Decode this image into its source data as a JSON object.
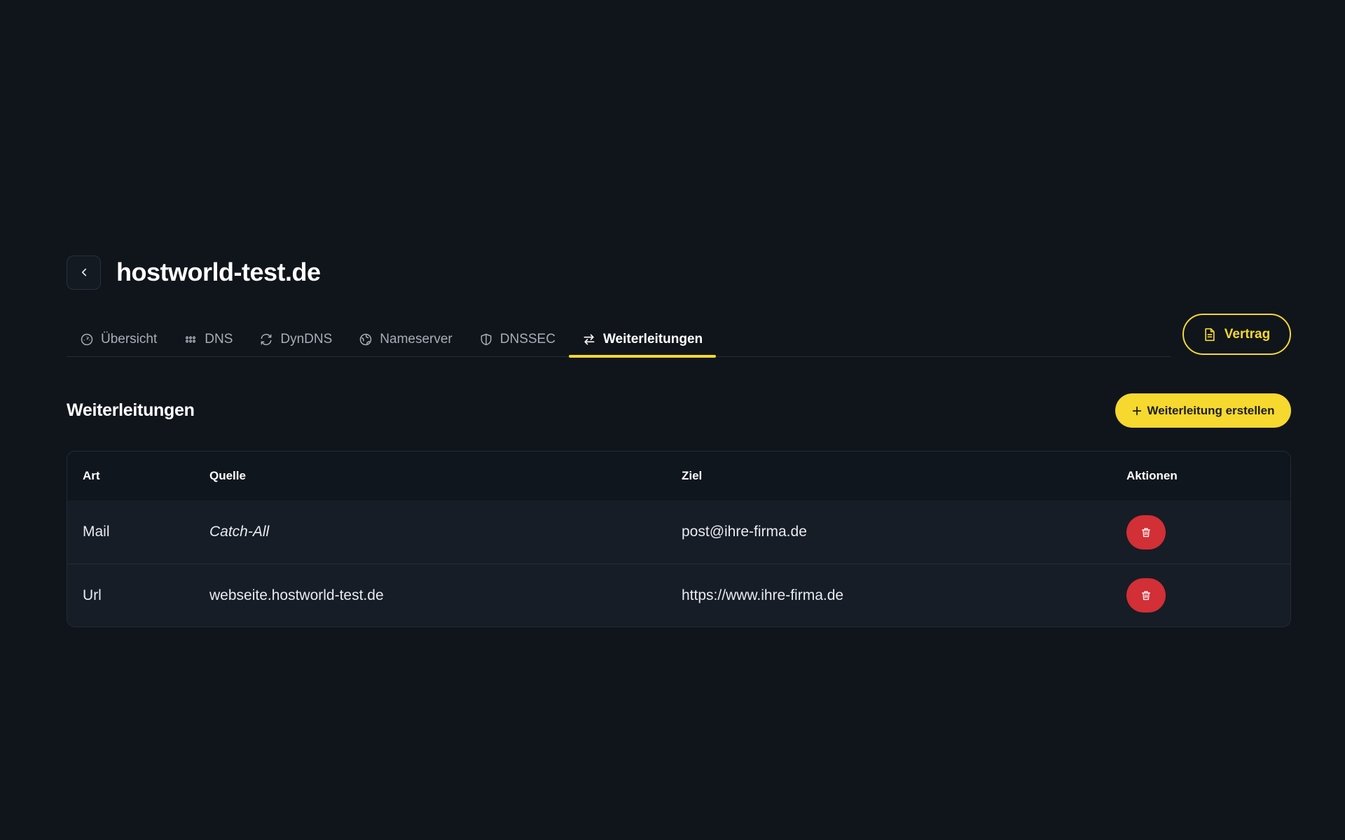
{
  "header": {
    "title": "hostworld-test.de"
  },
  "tabs": [
    {
      "label": "Übersicht",
      "icon": "gauge-icon",
      "active": false
    },
    {
      "label": "DNS",
      "icon": "grid-dots-icon",
      "active": false
    },
    {
      "label": "DynDNS",
      "icon": "refresh-icon",
      "active": false
    },
    {
      "label": "Nameserver",
      "icon": "globe-icon",
      "active": false
    },
    {
      "label": "DNSSEC",
      "icon": "shield-icon",
      "active": false
    },
    {
      "label": "Weiterleitungen",
      "icon": "arrows-swap-icon",
      "active": true
    }
  ],
  "contract": {
    "label": "Vertrag",
    "icon": "document-icon"
  },
  "section": {
    "title": "Weiterleitungen",
    "create_label": "Weiterleitung erstellen"
  },
  "table": {
    "columns": [
      "Art",
      "Quelle",
      "Ziel",
      "Aktionen"
    ],
    "rows": [
      {
        "type": "Mail",
        "source": "Catch-All",
        "target": "post@ihre-firma.de"
      },
      {
        "type": "Url",
        "source": "webseite.hostworld-test.de",
        "target": "https://www.ihre-firma.de"
      }
    ]
  },
  "colors": {
    "background": "#10151c",
    "accent": "#f6d82f",
    "danger": "#d22f36",
    "muted": "#a7adb6"
  }
}
